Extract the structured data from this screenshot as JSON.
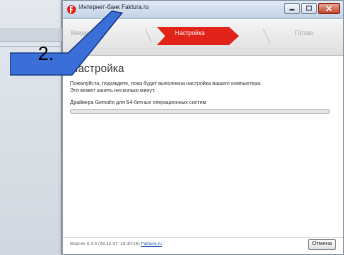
{
  "window": {
    "title": "Интернет-банк Faktura.ru"
  },
  "steps": [
    {
      "label": "Введение",
      "state": "done"
    },
    {
      "label": "Настройка",
      "state": "active"
    },
    {
      "label": "Готово",
      "state": "pending"
    }
  ],
  "main": {
    "title": "Настройка",
    "description_line1": "Пожалуйста, подождите, пока будет выполнена настройка вашего компьютера.",
    "description_line2": "Это может занять несколько минут.",
    "task_label": "Драйвера Gemalto для 64-битных операционных систем",
    "progress": 0.0
  },
  "footer": {
    "version_text": "Версия 6.3.9 (08.12.07, 18:30:19)",
    "link_text": "Faktura.ru",
    "cancel_label": "Отмена"
  },
  "annotation": {
    "number": "2.",
    "color": "#3a6fd8"
  },
  "colors": {
    "brand": "#e2231a",
    "background": "#b9c4d1"
  }
}
